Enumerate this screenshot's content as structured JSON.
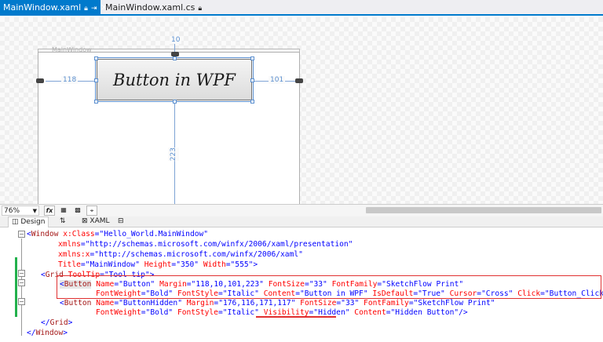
{
  "tabs": [
    {
      "label": "MainWindow.xaml",
      "active": true
    },
    {
      "label": "MainWindow.xaml.cs",
      "active": false
    }
  ],
  "designer": {
    "window_title": "MainWindow",
    "margin_top": "10",
    "margin_left": "118",
    "margin_right": "101",
    "margin_bottom": "223",
    "button_text": "Button in WPF"
  },
  "toolbar": {
    "zoom": "76%",
    "fx_label": "fx"
  },
  "split_tabs": {
    "design": "Design",
    "swap": "⇅",
    "xaml": "XAML"
  },
  "code": {
    "l1": [
      "<",
      "Window",
      " x:Class",
      "=",
      "\"Hello_World.MainWindow\""
    ],
    "l2": [
      "xmlns",
      "=",
      "\"http://schemas.microsoft.com/winfx/2006/xaml/presentation\""
    ],
    "l3": [
      "xmlns:x",
      "=",
      "\"http://schemas.microsoft.com/winfx/2006/xaml\""
    ],
    "l4": [
      "Title",
      "=",
      "\"MainWindow\"",
      " Height",
      "=",
      "\"350\"",
      " Width",
      "=",
      "\"555\"",
      ">"
    ],
    "l5": [
      "<",
      "Grid",
      " ToolTip",
      "=",
      "\"Tool tip\"",
      ">"
    ],
    "l6": [
      "<",
      "Button",
      " Name",
      "=",
      "\"Button\"",
      " Margin",
      "=",
      "\"118,10,101,223\"",
      " FontSize",
      "=",
      "\"33\"",
      " FontFamily",
      "=",
      "\"SketchFlow Print\""
    ],
    "l7": [
      "FontWeight",
      "=",
      "\"Bold\"",
      " FontStyle",
      "=",
      "\"Italic\"",
      " Content",
      "=",
      "\"Button in WPF\"",
      " IsDefault",
      "=",
      "\"True\"",
      " Cursor",
      "=",
      "\"Cross\"",
      " Click",
      "=",
      "\"Button_Click\"",
      " />"
    ],
    "l8": [
      "<",
      "Button",
      " Name",
      "=",
      "\"ButtonHidden\"",
      " Margin",
      "=",
      "\"176,116,171,117\"",
      " FontSize",
      "=",
      "\"33\"",
      " FontFamily",
      "=",
      "\"SketchFlow Print\""
    ],
    "l9": [
      "FontWeight",
      "=",
      "\"Bold\"",
      " FontStyle",
      "=",
      "\"Italic\"",
      " Visibility",
      "=",
      "\"Hidden\"",
      " Content",
      "=",
      "\"Hidden Button\"",
      "/>"
    ],
    "l10": [
      "</",
      "Grid",
      ">"
    ],
    "l11": [
      "</",
      "Window",
      ">"
    ]
  },
  "colors": {
    "accent": "#007acc",
    "highlight": "#e03030",
    "change_bar": "#22b14c"
  }
}
